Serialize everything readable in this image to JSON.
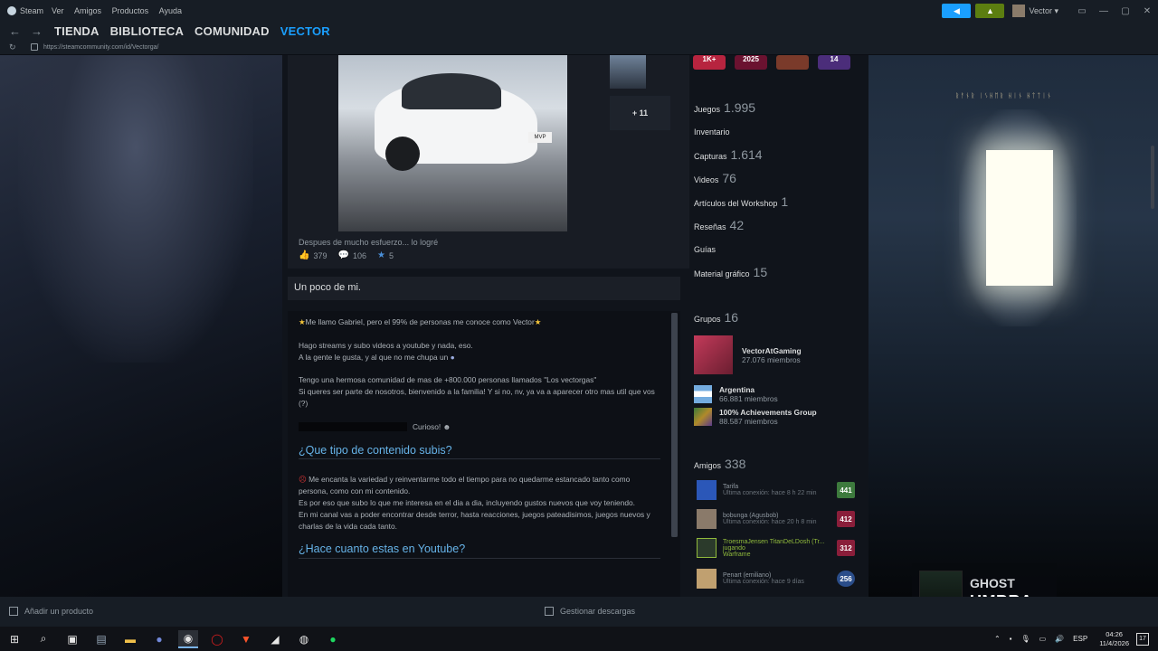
{
  "titlebar": {
    "app": "Steam",
    "menu": [
      "Ver",
      "Amigos",
      "Productos",
      "Ayuda"
    ],
    "user": "Vector",
    "accent": "#1a9fff"
  },
  "nav": {
    "items": [
      "TIENDA",
      "BIBLIOTECA",
      "COMUNIDAD",
      "VECTOR"
    ],
    "active_index": 3,
    "url": "https://steamcommunity.com/id/Vectorga/"
  },
  "showcase": {
    "more_label": "+ 11",
    "caption": "Despues de mucho esfuerzo... lo logré",
    "plate": "MVP",
    "likes": "379",
    "comments": "106",
    "awards": "5"
  },
  "about": {
    "header": "Un poco de mi.",
    "line1": "Me llamo Gabriel, pero el 99% de personas me conoce como Vector",
    "line2": "Hago streams y subo videos a youtube y nada, eso.",
    "line3": "A la gente le gusta, y al que no me chupa un",
    "line4": "Tengo una hermosa comunidad de mas de +800.000 personas llamados \"Los vectorgas\"",
    "line5": "Si queres ser parte de nosotros, bienvenido a la familia! Y si no, nv, ya va a aparecer otro mas util que vos (?)",
    "curioso": "Curioso!",
    "heading1": "¿Que tipo de contenido subis?",
    "p2_1": "Me encanta la variedad y reinventarme todo el tiempo para no quedarme estancado tanto como persona, como con mi contenido.",
    "p2_2": "Es por eso que subo lo que me interesa en el dia a dia, incluyendo gustos nuevos que voy teniendo.",
    "p2_3": "En mi canal vas a poder encontrar desde terror, hasta reacciones, juegos pateadisimos, juegos nuevos y charlas de la vida cada tanto.",
    "heading2": "¿Hace cuanto estas en Youtube?"
  },
  "badges": [
    "1K+",
    "2025",
    "",
    "14"
  ],
  "stats": [
    {
      "label": "Juegos",
      "value": "1.995"
    },
    {
      "label": "Inventario",
      "value": ""
    },
    {
      "label": "Capturas",
      "value": "1.614"
    },
    {
      "label": "Videos",
      "value": "76"
    },
    {
      "label": "Artículos del Workshop",
      "value": "1"
    },
    {
      "label": "Reseñas",
      "value": "42"
    },
    {
      "label": "Guías",
      "value": ""
    },
    {
      "label": "Material gráfico",
      "value": "15"
    }
  ],
  "groups": {
    "label": "Grupos",
    "count": "16",
    "items": [
      {
        "name": "VectorAtGaming",
        "members": "27.076 miembros"
      },
      {
        "name": "Argentina",
        "members": "66.881 miembros"
      },
      {
        "name": "100% Achievements Group",
        "members": "88.587 miembros"
      }
    ]
  },
  "friends": {
    "label": "Amigos",
    "count": "338",
    "items": [
      {
        "name": "Tarifa",
        "status": "Última conexión: hace 8 h 22 min",
        "level": "441",
        "color": "#3d7a3d"
      },
      {
        "name": "bobunga (Agusbob)",
        "status": "Última conexión: hace 20 h 8 min",
        "level": "412",
        "color": "#8a1e3a"
      },
      {
        "name": "TroesmaJensen TitanDeLDosh (Tr...",
        "status": "jugando",
        "status2": "Warframe",
        "level": "312",
        "color": "#8a1e3a"
      },
      {
        "name": "Penart (emiliano)",
        "status": "Última conexión: hace 9 días",
        "level": "256",
        "color": "#2a4d8a"
      }
    ]
  },
  "streamer": {
    "line1": "GHOST",
    "line2": "UMBRA"
  },
  "steambar": {
    "add_label": "Añadir un producto",
    "downloads_label": "Gestionar descargas"
  },
  "taskbar": {
    "lang": "ESP",
    "time": "04:26",
    "date": "11/4/2026",
    "notifications": "17"
  },
  "wallpaper": {
    "runes": "ᚱᚨᚾᚱ ᛁᛊᚺᛖᚱ ᚺᛁᚾ ᚺᛏᛏᛁᚾ"
  }
}
